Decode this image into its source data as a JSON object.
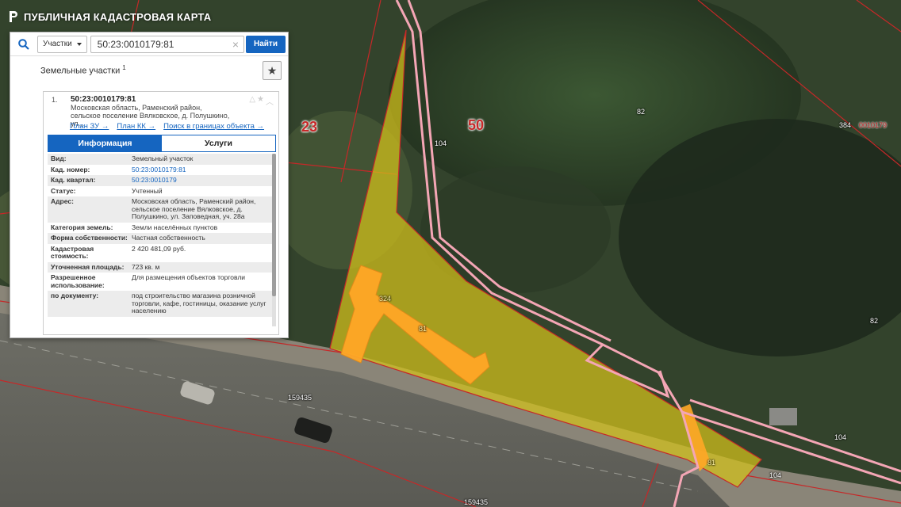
{
  "header": {
    "title": "ПУБЛИЧНАЯ КАДАСТРОВАЯ КАРТА"
  },
  "search": {
    "type_label": "Участки",
    "query": "50:23:0010179:81",
    "clear_glyph": "×",
    "button_label": "Найти"
  },
  "section": {
    "title": "Земельные участки",
    "count": "1"
  },
  "card": {
    "number": "1.",
    "cadastral_id": "50:23:0010179:81",
    "address_short": "Московская область, Раменский район, сельское поселение Вялковское, д. Полушкино, ул...",
    "links": [
      "План ЗУ →",
      "План КК →",
      "Поиск в границах объекта →"
    ],
    "tabs": [
      "Информация",
      "Услуги"
    ],
    "active_tab": 0
  },
  "properties": [
    {
      "key": "Вид:",
      "value": "Земельный участок",
      "link": false
    },
    {
      "key": "Кад. номер:",
      "value": "50:23:0010179:81",
      "link": true
    },
    {
      "key": "Кад. квартал:",
      "value": "50:23:0010179",
      "link": true
    },
    {
      "key": "Статус:",
      "value": "Учтенный",
      "link": false
    },
    {
      "key": "Адрес:",
      "value": "Московская область, Раменский район, сельское поселение Вялковское, д. Полушкино, ул. Заповедная, уч. 28а",
      "link": false
    },
    {
      "key": "Категория земель:",
      "value": "Земли населённых пунктов",
      "link": false
    },
    {
      "key": "Форма собственности:",
      "value": "Частная собственность",
      "link": false
    },
    {
      "key": "Кадастровая стоимость:",
      "value": "2 420 481,09 руб.",
      "link": false
    },
    {
      "key": "Уточненная площадь:",
      "value": "723 кв. м",
      "link": false
    },
    {
      "key": "Разрешенное использование:",
      "value": "Для размещения объектов торговли",
      "link": false
    },
    {
      "key": "по документу:",
      "value": "под строительство магазина розничной торговли, кафе, гостиницы, оказание услуг населению",
      "link": false
    }
  ],
  "map": {
    "labels": {
      "district_23": "23",
      "district_50": "50",
      "l104_top": "104",
      "l82_top": "82",
      "l384": "384",
      "l0010179": "0010179",
      "l82_right": "82",
      "l324": "324",
      "l81_center": "81",
      "l81_bottom": "81",
      "l159435_a": "159435",
      "l159435_b": "159435",
      "l104_right": "104",
      "l104_bottom": "104"
    },
    "colors": {
      "parcel_fill": "#d4c21a",
      "building_fill": "#ffa726",
      "boundary_red": "#c62828",
      "boundary_pink": "#f4a6b5",
      "accent_blue": "#1565c0"
    }
  }
}
